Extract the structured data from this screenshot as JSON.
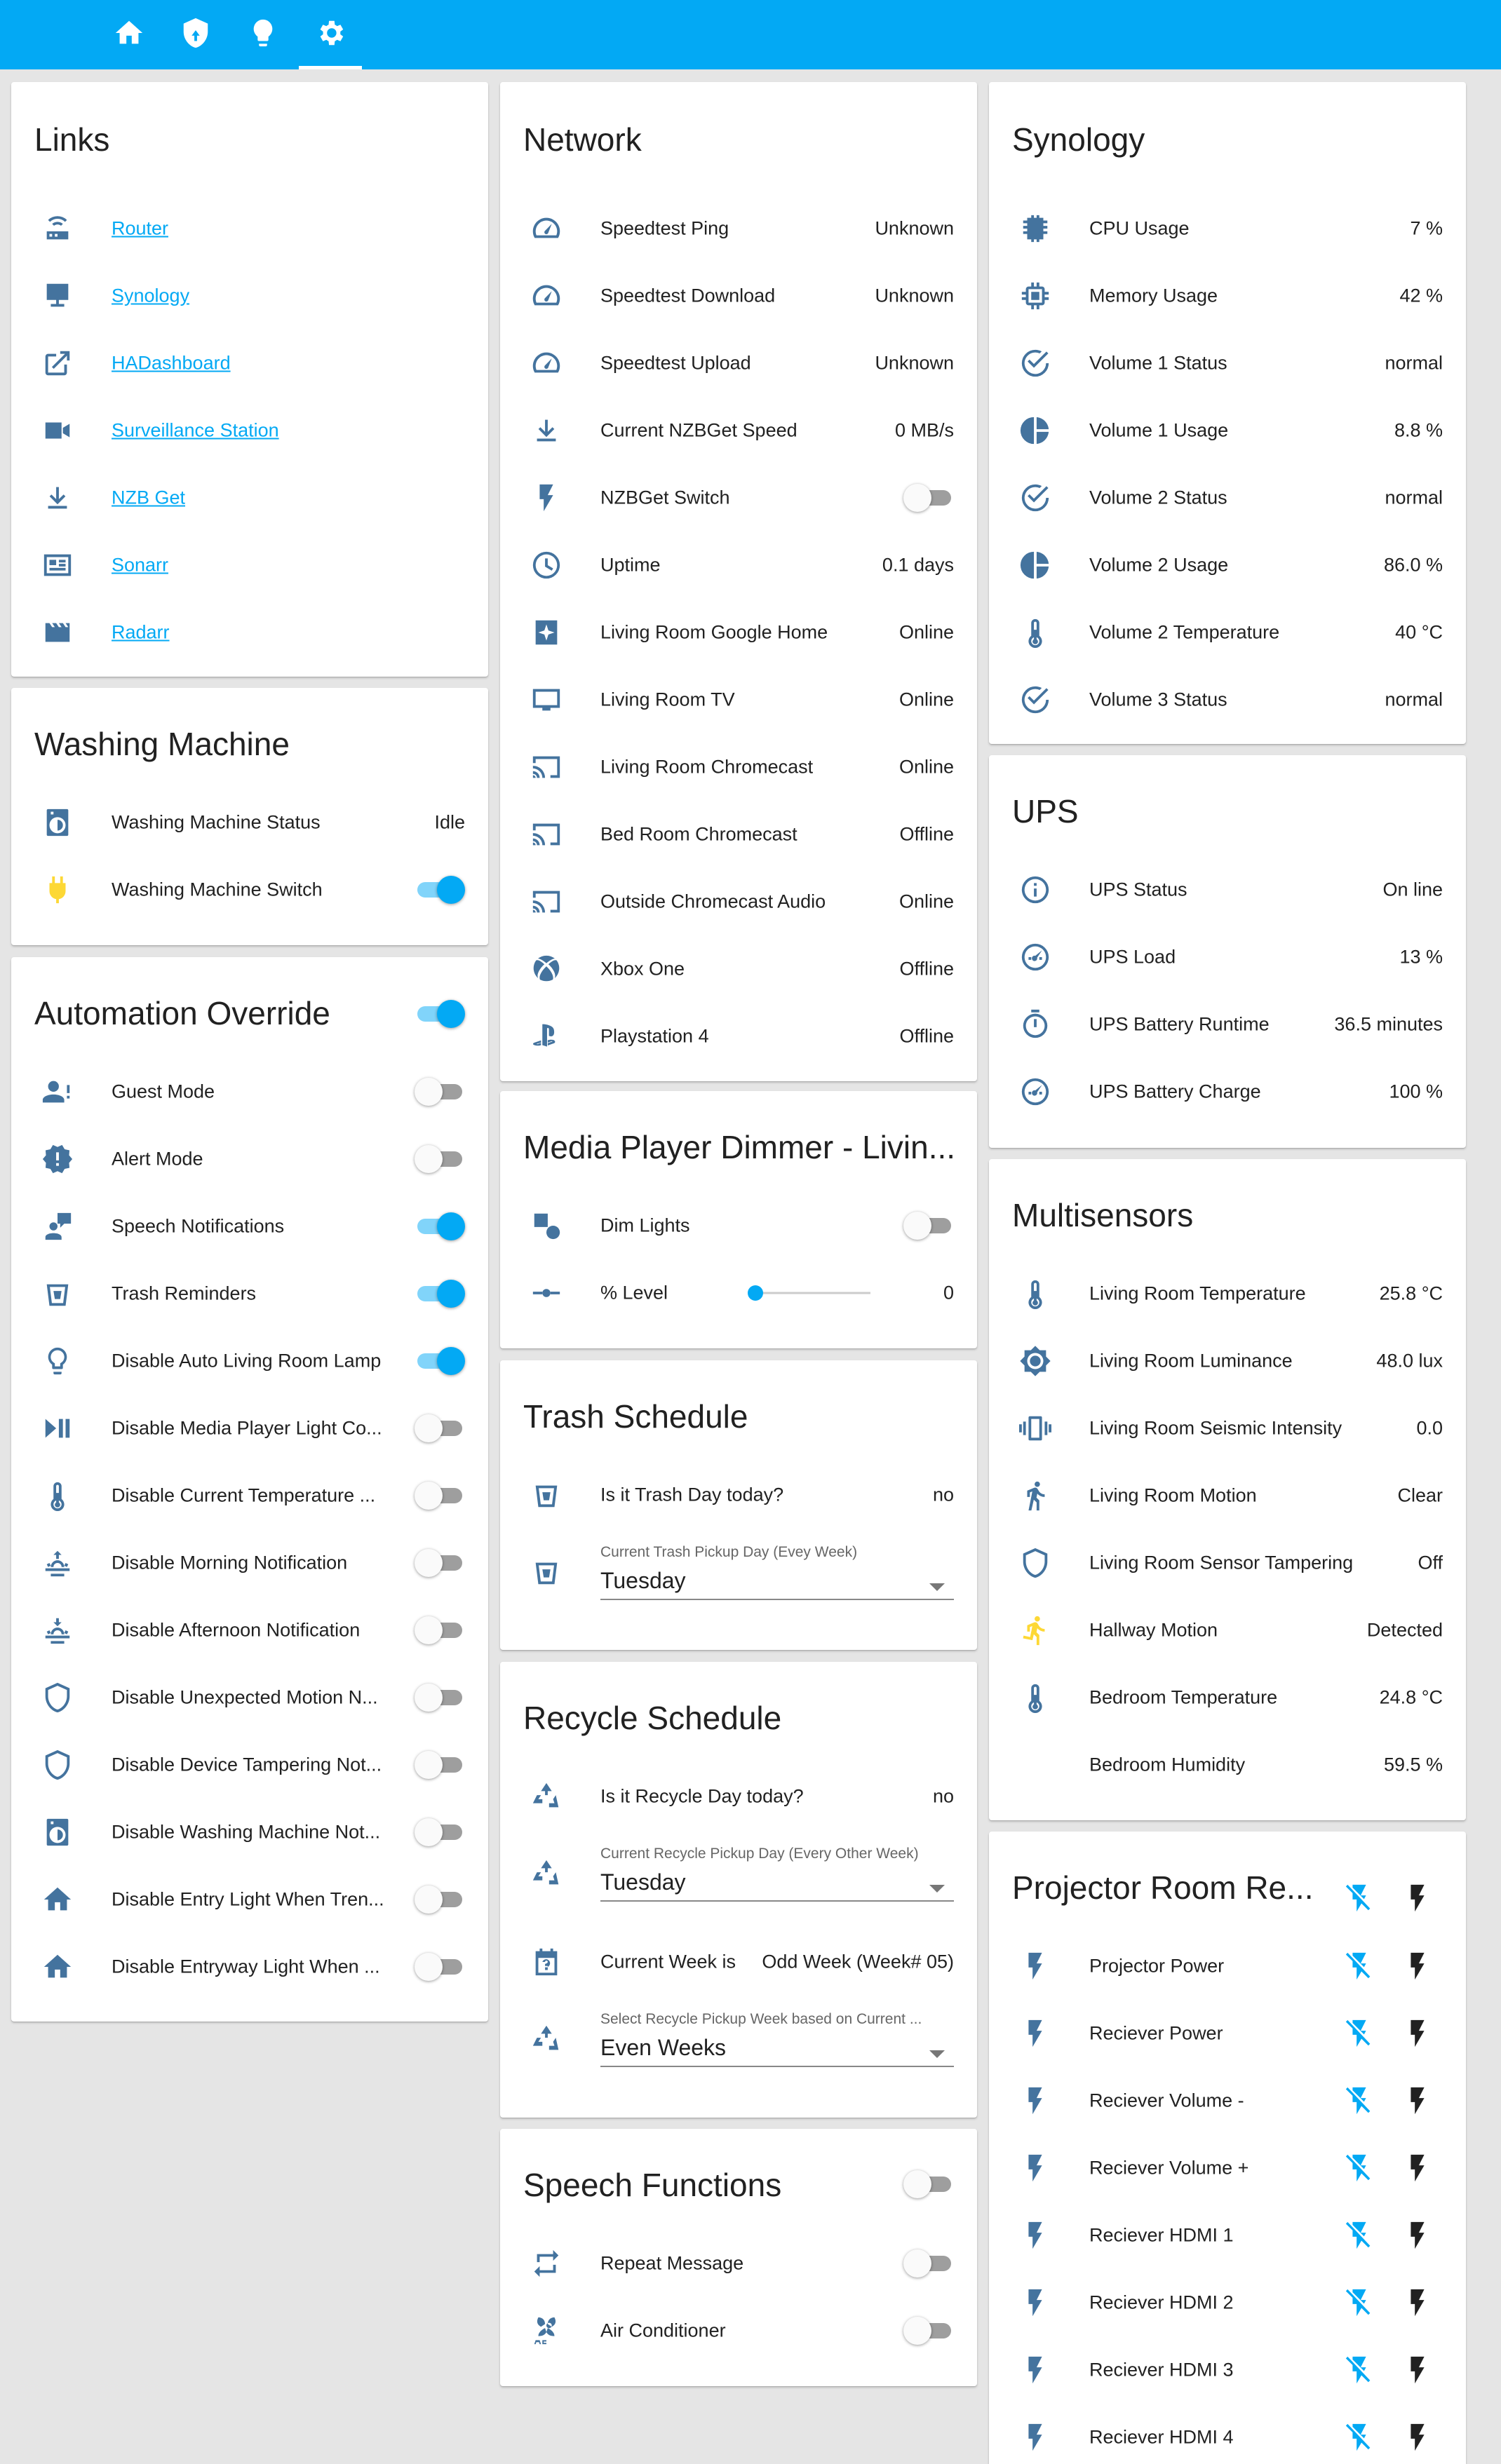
{
  "header": {
    "tabs": [
      {
        "icon": "home-icon"
      },
      {
        "icon": "shield-home-icon"
      },
      {
        "icon": "lightbulb-icon"
      },
      {
        "icon": "settings-icon",
        "active": true
      }
    ]
  },
  "links": {
    "title": "Links",
    "items": [
      {
        "icon": "router-icon",
        "label": "Router"
      },
      {
        "icon": "desktop-tower-icon",
        "label": "Synology"
      },
      {
        "icon": "open-in-new-icon",
        "label": "HADashboard"
      },
      {
        "icon": "video-camera-icon",
        "label": "Surveillance Station"
      },
      {
        "icon": "download-icon",
        "label": "NZB Get"
      },
      {
        "icon": "newspaper-icon",
        "label": "Sonarr"
      },
      {
        "icon": "movie-clapper-icon",
        "label": "Radarr"
      }
    ]
  },
  "washing": {
    "title": "Washing Machine",
    "status": {
      "icon": "washing-machine-icon",
      "label": "Washing Machine Status",
      "value": "Idle"
    },
    "switch": {
      "icon": "power-plug-icon",
      "label": "Washing Machine Switch",
      "on": true
    }
  },
  "automation": {
    "title": "Automation Override",
    "header_toggle_on": true,
    "items": [
      {
        "icon": "account-alert-icon",
        "label": "Guest Mode",
        "on": false
      },
      {
        "icon": "alert-decagram-icon",
        "label": "Alert Mode",
        "on": false
      },
      {
        "icon": "speech-bubble-icon",
        "label": "Speech Notifications",
        "on": true
      },
      {
        "icon": "trash-can-icon",
        "label": "Trash Reminders",
        "on": true
      },
      {
        "icon": "lightbulb-outline-icon",
        "label": "Disable Auto Living Room Lamp",
        "on": true
      },
      {
        "icon": "play-pause-icon",
        "label": "Disable Media Player Light Co...",
        "on": false
      },
      {
        "icon": "thermometer-icon",
        "label": "Disable Current Temperature ...",
        "on": false
      },
      {
        "icon": "weather-sunrise-icon",
        "label": "Disable Morning Notification",
        "on": false
      },
      {
        "icon": "weather-sunset-icon",
        "label": "Disable Afternoon Notification",
        "on": false
      },
      {
        "icon": "shield-outline-icon",
        "label": "Disable Unexpected Motion N...",
        "on": false
      },
      {
        "icon": "shield-outline-icon",
        "label": "Disable Device Tampering Not...",
        "on": false
      },
      {
        "icon": "washing-machine-icon",
        "label": "Disable Washing Machine Not...",
        "on": false
      },
      {
        "icon": "home-icon",
        "label": "Disable Entry Light When Tren...",
        "on": false
      },
      {
        "icon": "home-icon",
        "label": "Disable Entryway Light When ...",
        "on": false
      }
    ]
  },
  "network": {
    "title": "Network",
    "items": [
      {
        "icon": "speedometer-icon",
        "label": "Speedtest Ping",
        "value": "Unknown"
      },
      {
        "icon": "speedometer-icon",
        "label": "Speedtest Download",
        "value": "Unknown"
      },
      {
        "icon": "speedometer-icon",
        "label": "Speedtest Upload",
        "value": "Unknown"
      },
      {
        "icon": "download-icon",
        "label": "Current NZBGet Speed",
        "value": "0 MB/s"
      },
      {
        "icon": "flash-icon",
        "label": "NZBGet Switch",
        "toggle": true,
        "on": false
      },
      {
        "icon": "clock-outline-icon",
        "label": "Uptime",
        "value": "0.1 days"
      },
      {
        "icon": "google-home-icon",
        "label": "Living Room Google Home",
        "value": "Online"
      },
      {
        "icon": "television-icon",
        "label": "Living Room TV",
        "value": "Online"
      },
      {
        "icon": "cast-icon",
        "label": "Living Room Chromecast",
        "value": "Online"
      },
      {
        "icon": "cast-icon",
        "label": "Bed Room Chromecast",
        "value": "Offline"
      },
      {
        "icon": "cast-icon",
        "label": "Outside Chromecast Audio",
        "value": "Online"
      },
      {
        "icon": "xbox-icon",
        "label": "Xbox One",
        "value": "Offline"
      },
      {
        "icon": "playstation-icon",
        "label": "Playstation 4",
        "value": "Offline"
      }
    ]
  },
  "media_dimmer": {
    "title": "Media Player Dimmer - Livin...",
    "dim": {
      "icon": "shape-icon",
      "label": "Dim Lights",
      "on": false
    },
    "level": {
      "icon": "ray-vertex-icon",
      "label": "% Level",
      "value": "0",
      "fraction": 0
    }
  },
  "trash": {
    "title": "Trash Schedule",
    "today": {
      "icon": "trash-can-icon",
      "label": "Is it Trash Day today?",
      "value": "no"
    },
    "pickup": {
      "icon": "trash-can-icon",
      "label": "Current Trash Pickup Day (Evey Week)",
      "value": "Tuesday"
    }
  },
  "recycle": {
    "title": "Recycle Schedule",
    "today": {
      "icon": "recycle-icon",
      "label": "Is it Recycle Day today?",
      "value": "no"
    },
    "pickup": {
      "icon": "recycle-icon",
      "label": "Current Recycle Pickup Day (Every Other Week)",
      "value": "Tuesday"
    },
    "week": {
      "icon": "calendar-question-icon",
      "label": "Current Week is",
      "value": "Odd Week (Week# 05)"
    },
    "select": {
      "icon": "recycle-icon",
      "label": "Select Recycle Pickup Week based on Current ...",
      "value": "Even Weeks"
    }
  },
  "speech": {
    "title": "Speech Functions",
    "header_toggle_on": false,
    "items": [
      {
        "icon": "repeat-icon",
        "label": "Repeat Message",
        "on": false
      },
      {
        "icon": "air-conditioner-icon",
        "label": "Air Conditioner",
        "on": false
      }
    ]
  },
  "synology": {
    "title": "Synology",
    "items": [
      {
        "icon": "chip-icon",
        "label": "CPU Usage",
        "value": "7 %"
      },
      {
        "icon": "memory-icon",
        "label": "Memory Usage",
        "value": "42 %"
      },
      {
        "icon": "check-circle-outline-icon",
        "label": "Volume 1 Status",
        "value": "normal"
      },
      {
        "icon": "chart-pie-icon",
        "label": "Volume 1 Usage",
        "value": "8.8 %"
      },
      {
        "icon": "check-circle-outline-icon",
        "label": "Volume 2 Status",
        "value": "normal"
      },
      {
        "icon": "chart-pie-icon",
        "label": "Volume 2 Usage",
        "value": "86.0 %"
      },
      {
        "icon": "thermometer-icon",
        "label": "Volume 2 Temperature",
        "value": "40 °C"
      },
      {
        "icon": "check-circle-outline-icon",
        "label": "Volume 3 Status",
        "value": "normal"
      }
    ]
  },
  "ups": {
    "title": "UPS",
    "items": [
      {
        "icon": "information-outline-icon",
        "label": "UPS Status",
        "value": "On line"
      },
      {
        "icon": "gauge-icon",
        "label": "UPS Load",
        "value": "13 %"
      },
      {
        "icon": "timer-icon",
        "label": "UPS Battery Runtime",
        "value": "36.5 minutes"
      },
      {
        "icon": "gauge-icon",
        "label": "UPS Battery Charge",
        "value": "100 %"
      }
    ]
  },
  "multisensors": {
    "title": "Multisensors",
    "items": [
      {
        "icon": "thermometer-icon",
        "label": "Living Room Temperature",
        "value": "25.8 °C"
      },
      {
        "icon": "brightness-icon",
        "label": "Living Room Luminance",
        "value": "48.0 lux"
      },
      {
        "icon": "vibrate-icon",
        "label": "Living Room Seismic Intensity",
        "value": "0.0"
      },
      {
        "icon": "walk-icon",
        "label": "Living Room Motion",
        "value": "Clear"
      },
      {
        "icon": "shield-outline-icon",
        "label": "Living Room Sensor Tampering",
        "value": "Off"
      },
      {
        "icon": "run-icon",
        "label": "Hallway Motion",
        "value": "Detected"
      },
      {
        "icon": "thermometer-icon",
        "label": "Bedroom Temperature",
        "value": "24.8 °C"
      },
      {
        "icon": "",
        "label": "Bedroom Humidity",
        "value": "59.5 %"
      }
    ]
  },
  "projector": {
    "title": "Projector Room Re...",
    "items": [
      {
        "label": "Projector Power"
      },
      {
        "label": "Reciever Power"
      },
      {
        "label": "Reciever Volume -"
      },
      {
        "label": "Reciever Volume +"
      },
      {
        "label": "Reciever HDMI 1"
      },
      {
        "label": "Reciever HDMI 2"
      },
      {
        "label": "Reciever HDMI 3"
      },
      {
        "label": "Reciever HDMI 4"
      }
    ]
  },
  "colors": {
    "primary": "#03a9f4",
    "icon": "#44739e",
    "active_icon": "#fdd835",
    "background": "#e5e5e5"
  }
}
